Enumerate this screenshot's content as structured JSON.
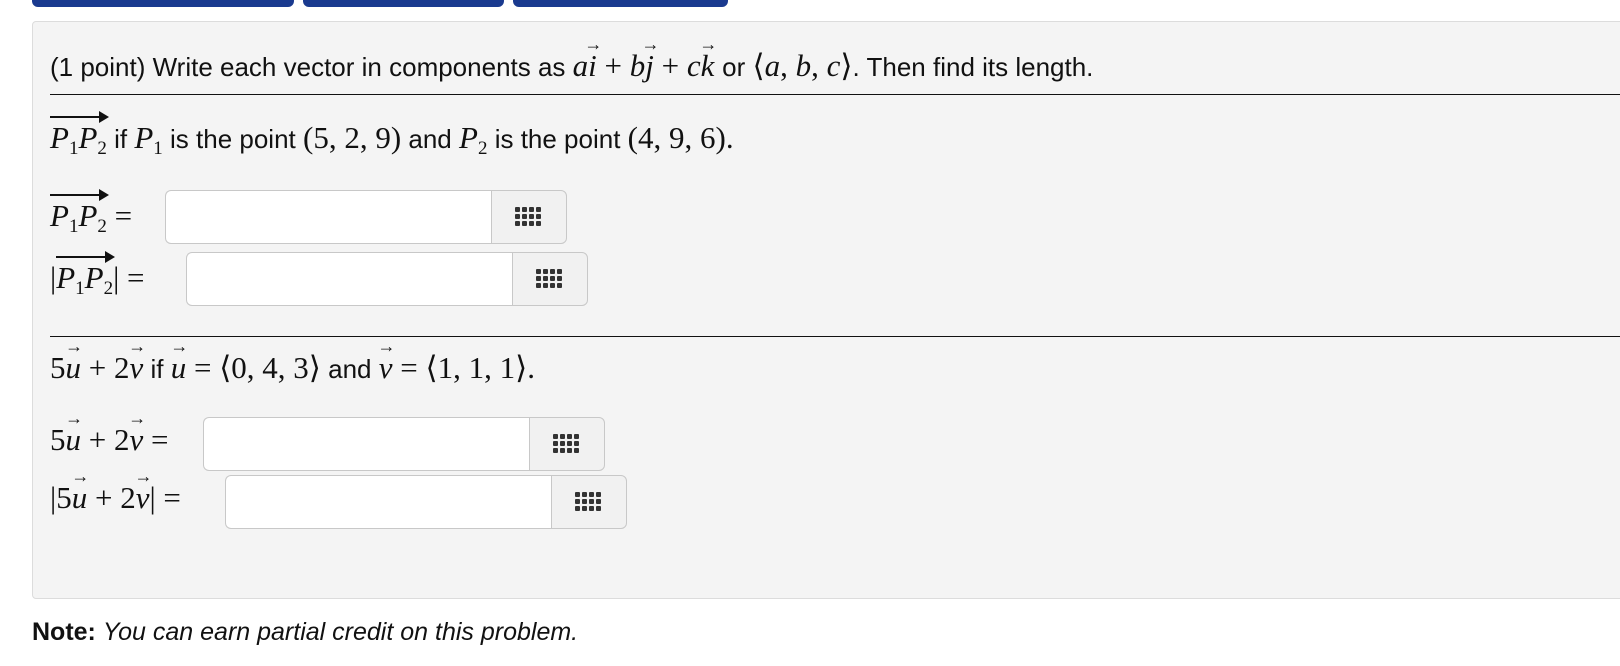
{
  "problem": {
    "intro_prefix": "(1 point) Write each vector in components as",
    "intro_mid": "or",
    "intro_suffix": ". Then find its length.",
    "basis_formula": "ai + bj + ck",
    "component_formula": "⟨a, b, c⟩"
  },
  "part1": {
    "vec_name": "P₁P₂",
    "statement_if": "if",
    "p1_name": "P₁",
    "statement_is1": "is the point",
    "p1_point": "(5, 2, 9)",
    "statement_and": "and",
    "p2_name": "P₂",
    "statement_is2": "is the point",
    "p2_point": "(4, 9, 6)",
    "statement_end": ".",
    "answer1_label": "P₁P₂ =",
    "answer1_value": "",
    "answer2_label": "|P₁P₂| =",
    "answer2_value": ""
  },
  "part2": {
    "expr": "5u + 2v",
    "statement_if": "if",
    "u_def": "u = ⟨0, 4, 3⟩",
    "statement_and": "and",
    "v_def": "v = ⟨1, 1, 1⟩",
    "statement_end": ".",
    "answer1_label": "5u + 2v =",
    "answer1_value": "",
    "answer2_label": "|5u + 2v| =",
    "answer2_value": ""
  },
  "note": {
    "bold": "Note:",
    "text": "You can earn partial credit on this problem."
  },
  "icons": {
    "keyboard": "keyboard-grid-icon"
  },
  "colors": {
    "top_button": "#1a3a8f",
    "panel_bg": "#f4f4f4"
  }
}
